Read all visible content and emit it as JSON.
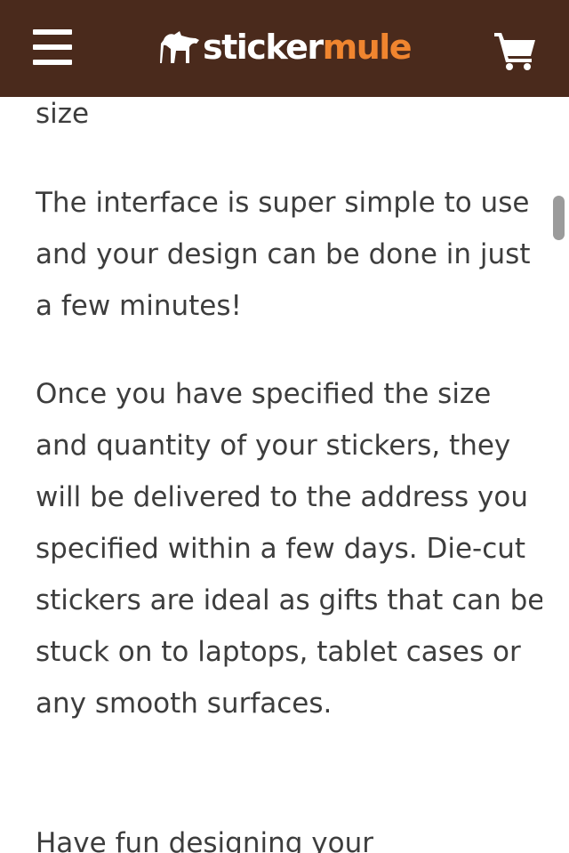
{
  "header": {
    "logo_text_primary": "sticker",
    "logo_text_accent": "mule",
    "brand_color": "#4a2a1c",
    "accent_color": "#f0852f",
    "menu_icon": "hamburger-menu-icon",
    "cart_icon": "shopping-cart-icon"
  },
  "article": {
    "fragment_top": "size",
    "paragraphs": [
      "The interface is super simple to use and your design can be done in just a few minutes!",
      "Once you have specified the size and quantity of your stickers, they will be delivered to the address you specified within a few days. Die-cut stickers are ideal as gifts that can be stuck on to laptops, tablet cases or any smooth surfaces.",
      "Have fun designing your"
    ]
  }
}
